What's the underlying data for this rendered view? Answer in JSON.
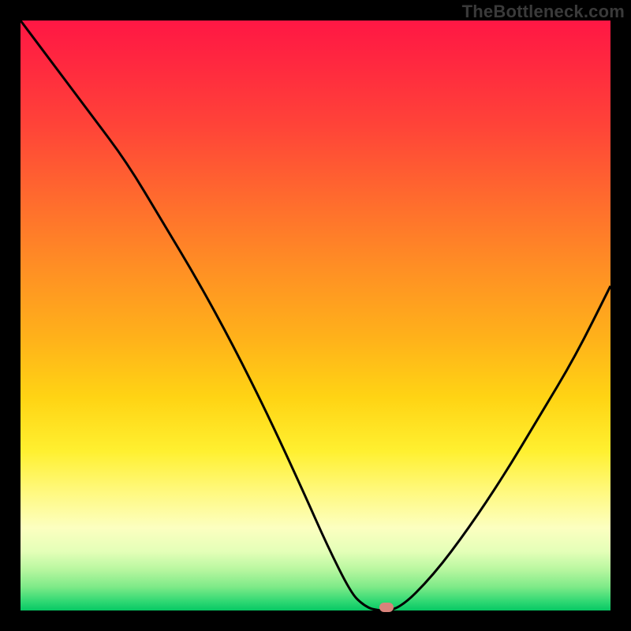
{
  "watermark": "TheBottleneck.com",
  "chart_data": {
    "type": "line",
    "title": "",
    "xlabel": "",
    "ylabel": "",
    "xlim": [
      0,
      100
    ],
    "ylim": [
      0,
      100
    ],
    "grid": false,
    "legend": false,
    "series": [
      {
        "name": "bottleneck-curve",
        "x": [
          0,
          6,
          12,
          18,
          24,
          30,
          36,
          42,
          48,
          52,
          56,
          58,
          60,
          64,
          70,
          76,
          82,
          88,
          94,
          100
        ],
        "y": [
          100,
          92,
          84,
          76,
          66,
          56,
          45,
          33,
          20,
          11,
          3,
          1,
          0,
          0,
          6,
          14,
          23,
          33,
          43,
          55
        ]
      }
    ],
    "marker": {
      "x": 62,
      "y": 0.5,
      "color": "#d9837b"
    },
    "background_gradient": {
      "stops": [
        {
          "pos": 0.0,
          "color": "#ff1744"
        },
        {
          "pos": 0.3,
          "color": "#ff6a2e"
        },
        {
          "pos": 0.55,
          "color": "#ffb21a"
        },
        {
          "pos": 0.75,
          "color": "#fff030"
        },
        {
          "pos": 0.9,
          "color": "#e4ffb8"
        },
        {
          "pos": 1.0,
          "color": "#07c864"
        }
      ]
    }
  }
}
